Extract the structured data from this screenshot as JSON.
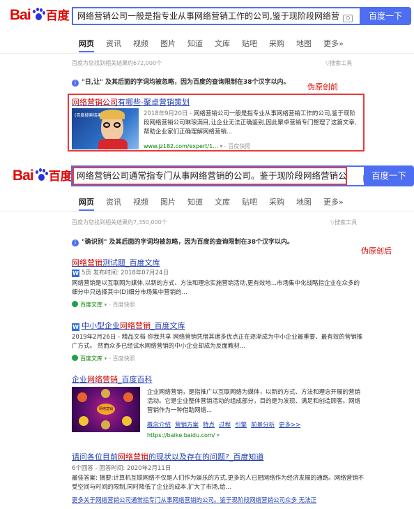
{
  "brand": {
    "bai": "Bai",
    "du": "du",
    "cn": "百度"
  },
  "top": {
    "query": "网络营销公司一般是指专业从事网络营销工作的公司,鉴于现阶段网络营",
    "search_btn": "百度一下",
    "tabs": [
      "网页",
      "资讯",
      "视频",
      "图片",
      "知道",
      "文库",
      "贴吧",
      "采购",
      "地图",
      "更多»"
    ],
    "count": "百度为您找到相关结果约672,000个",
    "tools": "▽搜索工具",
    "notice_q": "\"日,让\"",
    "notice_rest": " 及其后面的字词均被忽略，因为百度的查询限制在38个汉字以内。",
    "label": "伪原创前",
    "result": {
      "title_a": "网络营销公司",
      "title_b": "有哪些-聚卓营销策划",
      "date": "2018年9月20日 - ",
      "desc": "网络营销公司一般是指专业从事网络营销工作的公司,鉴于现阶段网络营销公司琳琅满目,让企业无法正确鉴别,因此聚卓营销专门整理了这篇文章,帮助企业家们正确理解网络营销...",
      "thumb_text": "(百度搜索结果)",
      "url": "www.jz182.com/expert/1...",
      "snap": "▾ - 百度快照"
    }
  },
  "bottom": {
    "query": "网络营销公司通常指专门从事网络营销的公司。鉴于现阶段网络营销公",
    "search_btn": "百度一下",
    "tabs": [
      "网页",
      "资讯",
      "视频",
      "图片",
      "知道",
      "文库",
      "贴吧",
      "采购",
      "地图",
      "更多»"
    ],
    "count": "百度为您找到相关结果约7,350,000个",
    "tools": "▽搜索工具",
    "notice_q": "\"确识别\"",
    "notice_rest": " 及其后面的字词均被忽略，因为百度的查询限制在38个汉字以内。",
    "label": "伪原创后",
    "results": [
      {
        "title_a": "网络营销",
        "title_b": "测试题_百度文库",
        "meta": "5页 发布时间: 2018年07月24日",
        "desc": "网络营销是以互联网为媒体,以新的方式、方法和理念实施营销活动,更有效地...市场集中化战略指企业在众多的细分中只选择其中(D)细分市场集中营销的...",
        "source": "百度文库",
        "snap": "▾ - 百度快照"
      },
      {
        "title_a": "中小型企业",
        "title_b": "网络营销",
        "title_c": "_百度文库",
        "meta": "2019年2月26日 - 精品文档 你我共享 网络营销凭借其诸多优点正在逐渐成为中小企业最重要、最有效的营销推广方式。 然而众多已经试水网络营销的中小企业却成为反面教材...",
        "source": "百度文库",
        "snap": "▾ - 百度快照"
      },
      {
        "title_a": "企业",
        "title_b": "网络营销",
        "title_c": "_百度百科",
        "desc": "企业网络营销，是指推广以互联网络为媒体，以新的方式、方法和理念开展的营销活动。它是企业整体营销活动的组成部分，目的是为发现、满足和创造顾客。网络营销作为一种借助网络...",
        "links": [
          "概念介绍",
          "营销方案",
          "特点",
          "过程",
          "引擎",
          "前景分析",
          "更多>>"
        ],
        "url": "https://baike.baidu.com/",
        "img_label": "网络营销"
      },
      {
        "title_a": "请问各位目前",
        "title_b": "网络营销",
        "title_c": "的现状以及存在的问题?_百度知道",
        "meta": "6个回答 - 回答时间: 2020年2月11日",
        "desc": "最佳答案: 摘要:计算机互联网络不仅是人们作为娱乐的方式,更多的人已把网络作为经济发展的通路。网络营销不受空间与时间的限制,同时降低了企业的成本,扩大了市场,给..."
      }
    ],
    "more_link": "更多关于网络营销公司通常指专门从事网络营销的公司。鉴于现阶段网络营销公司众多 无法正"
  },
  "colors": {
    "accent": "#4e6ef2",
    "red": "#e10602",
    "link": "#2440b3",
    "green": "#008000"
  }
}
